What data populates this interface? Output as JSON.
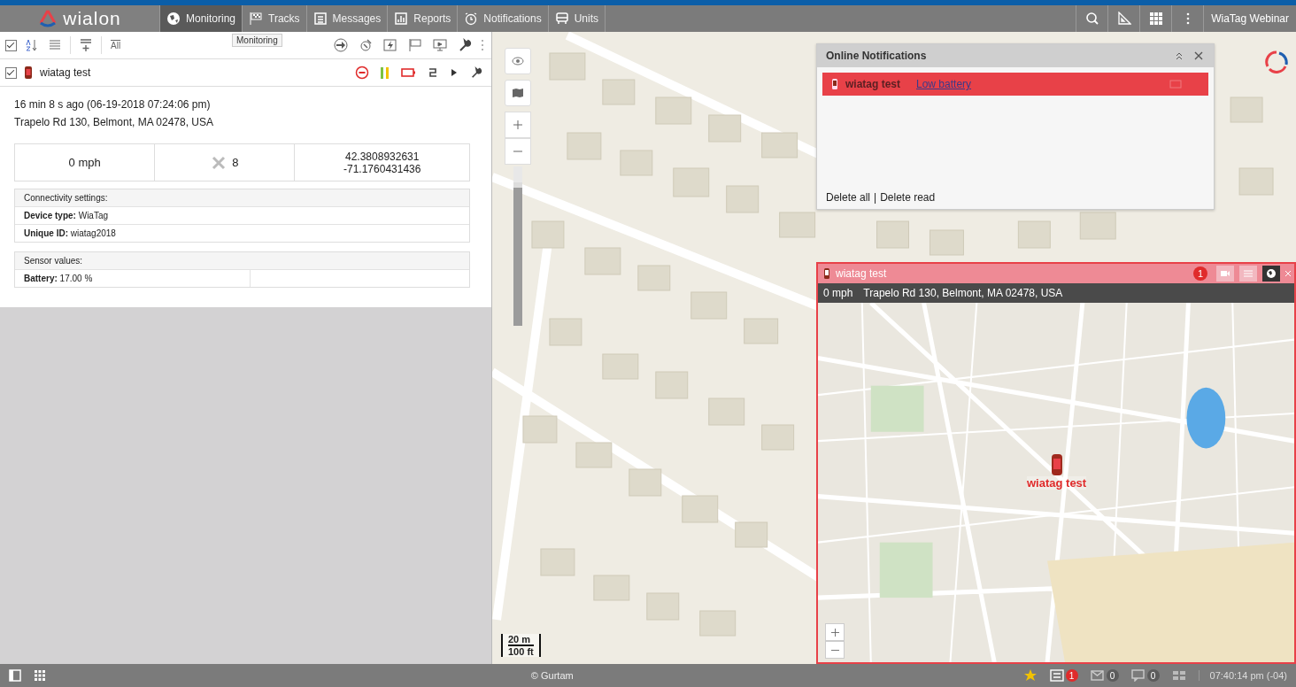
{
  "logo": {
    "text": "wialon"
  },
  "nav": {
    "tabs": [
      {
        "label": "Monitoring",
        "kind": "globe",
        "selected": true
      },
      {
        "label": "Tracks",
        "kind": "flag",
        "selected": false
      },
      {
        "label": "Messages",
        "kind": "doc",
        "selected": false
      },
      {
        "label": "Reports",
        "kind": "chart",
        "selected": false
      },
      {
        "label": "Notifications",
        "kind": "clock",
        "selected": false
      },
      {
        "label": "Units",
        "kind": "bus",
        "selected": false
      }
    ],
    "tooltip": "Monitoring",
    "user": "WiaTag Webinar"
  },
  "panel": {
    "toolbar": {
      "all_label": "All",
      "select_all": true
    },
    "unit": {
      "name": "wiatag test",
      "checked": true
    },
    "last_message": "16 min 8 s ago (06-19-2018 07:24:06 pm)",
    "address": "Trapelo Rd 130, Belmont, MA 02478, USA",
    "speed": "0 mph",
    "satellites": "8",
    "latitude": "42.3808932631",
    "longitude": "-71.1760431436",
    "connectivity": {
      "title": "Connectivity settings:",
      "rows": [
        {
          "label": "Device type:",
          "value": "WiaTag"
        },
        {
          "label": "Unique ID:",
          "value": "wiatag2018"
        }
      ]
    },
    "sensors": {
      "title": "Sensor values:",
      "rows": [
        {
          "label": "Battery:",
          "value": "17.00 %"
        }
      ]
    }
  },
  "map": {
    "zoom_slider": {
      "level": 0.9
    },
    "scale": {
      "metric": "20 m",
      "imperial": "100 ft"
    }
  },
  "notifications": {
    "title": "Online Notifications",
    "items": [
      {
        "unit": "wiatag test",
        "event": "Low battery",
        "color": "#e84148"
      }
    ],
    "delete_all": "Delete all",
    "separator": "|",
    "delete_read": "Delete read"
  },
  "unit_window": {
    "title": "wiatag test",
    "badge": "1",
    "speed": "0 mph",
    "address": "Trapelo Rd 130, Belmont, MA 02478, USA",
    "marker_label": "wiatag test",
    "buttons": [
      {
        "kind": "video",
        "selected": false
      },
      {
        "kind": "list",
        "selected": false
      },
      {
        "kind": "globe",
        "selected": true
      }
    ]
  },
  "status_bar": {
    "copyright": "© Gurtam",
    "counters": [
      {
        "kind": "notes",
        "count": "1",
        "color": "#e02b2b"
      },
      {
        "kind": "mail",
        "count": "0",
        "color": "#5c5c5c"
      },
      {
        "kind": "chat",
        "count": "0",
        "color": "#5c5c5c"
      }
    ],
    "time": "07:40:14 pm (-04)"
  }
}
